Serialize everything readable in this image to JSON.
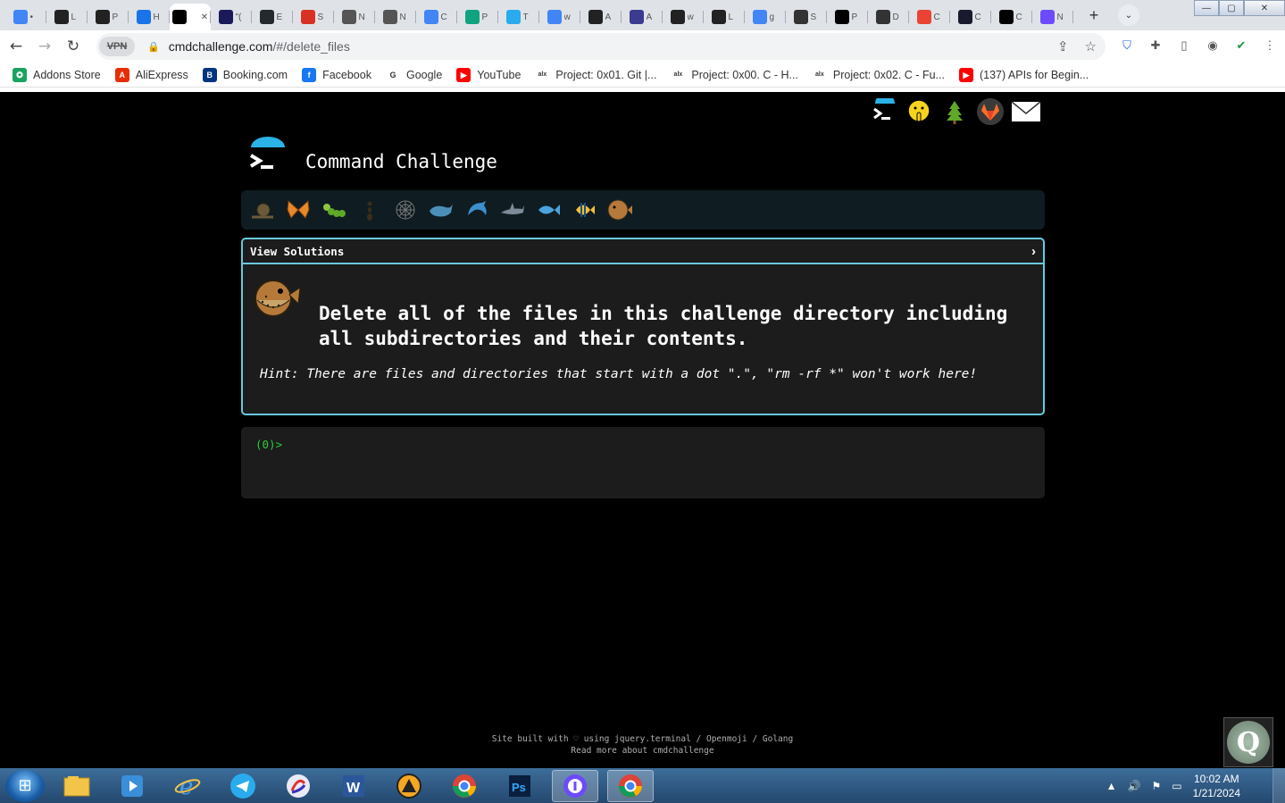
{
  "browser": {
    "tabs": [
      {
        "icon": "chrome-icon",
        "text": "•",
        "color": "#4285f4"
      },
      {
        "icon": "alx-icon",
        "text": "L",
        "color": "#222"
      },
      {
        "icon": "alx-icon",
        "text": "P",
        "color": "#222"
      },
      {
        "icon": "refresh-icon",
        "text": "H",
        "color": "#1a73e8"
      },
      {
        "icon": "terminal-icon",
        "text": "",
        "color": "#000",
        "active": true
      },
      {
        "icon": "intellij-icon",
        "text": "\"(",
        "color": "#1a1a5a"
      },
      {
        "icon": "github-icon",
        "text": "E",
        "color": "#24292e"
      },
      {
        "icon": "gmail-icon",
        "text": "S",
        "color": "#d93025"
      },
      {
        "icon": "alx-icon",
        "text": "N",
        "color": "#555"
      },
      {
        "icon": "alx-icon",
        "text": "N",
        "color": "#555"
      },
      {
        "icon": "docs-icon",
        "text": "C",
        "color": "#4285f4"
      },
      {
        "icon": "chatgpt-icon",
        "text": "P",
        "color": "#10a37f"
      },
      {
        "icon": "telegram-icon",
        "text": "T",
        "color": "#2aabee"
      },
      {
        "icon": "google-icon",
        "text": "w",
        "color": "#4285f4"
      },
      {
        "icon": "alx-icon",
        "text": "A",
        "color": "#222"
      },
      {
        "icon": "globe-icon",
        "text": "A",
        "color": "#3b3b8f"
      },
      {
        "icon": "alx-icon",
        "text": "w",
        "color": "#222"
      },
      {
        "icon": "alx-icon",
        "text": "L",
        "color": "#222"
      },
      {
        "icon": "google-icon",
        "text": "g",
        "color": "#4285f4"
      },
      {
        "icon": "gear-icon",
        "text": "S",
        "color": "#333"
      },
      {
        "icon": "network-icon",
        "text": "P",
        "color": "#000"
      },
      {
        "icon": "download-icon",
        "text": "D",
        "color": "#333"
      },
      {
        "icon": "google-icon",
        "text": "C",
        "color": "#ea4335"
      },
      {
        "icon": "ai-icon",
        "text": "C",
        "color": "#1a1a2e"
      },
      {
        "icon": "terminal-icon",
        "text": "C",
        "color": "#000"
      },
      {
        "icon": "proton-icon",
        "text": "N",
        "color": "#6d4aff"
      }
    ],
    "url_host": "cmdchallenge.com",
    "url_path": "/#/delete_files",
    "vpn_label": "VPN",
    "bookmarks": [
      {
        "label": "Addons Store",
        "icon": "addons-icon",
        "color": "#1aa260",
        "glyph": "✪"
      },
      {
        "label": "AliExpress",
        "icon": "aliexpress-icon",
        "color": "#e62e04",
        "glyph": "A"
      },
      {
        "label": "Booking.com",
        "icon": "booking-icon",
        "color": "#003580",
        "glyph": "B"
      },
      {
        "label": "Facebook",
        "icon": "facebook-icon",
        "color": "#1877f2",
        "glyph": "f"
      },
      {
        "label": "Google",
        "icon": "google-icon",
        "color": "#ffffff",
        "glyph": "G"
      },
      {
        "label": "YouTube",
        "icon": "youtube-icon",
        "color": "#ff0000",
        "glyph": "▶"
      },
      {
        "label": "Project: 0x01. Git |...",
        "icon": "alx-icon",
        "color": "#ffffff",
        "glyph": "alx"
      },
      {
        "label": "Project: 0x00. C - H...",
        "icon": "alx-icon",
        "color": "#ffffff",
        "glyph": "alx"
      },
      {
        "label": "Project: 0x02. C - Fu...",
        "icon": "alx-icon",
        "color": "#ffffff",
        "glyph": "alx"
      },
      {
        "label": "(137) APIs for Begin...",
        "icon": "youtube-icon",
        "color": "#ff0000",
        "glyph": "▶"
      }
    ]
  },
  "site": {
    "title": "Command Challenge",
    "top_icons": [
      "terminal-icon",
      "shushing-face-icon",
      "tree-icon",
      "gitlab-icon",
      "mail-icon"
    ],
    "animals": [
      "snail",
      "butterfly",
      "caterpillar",
      "ant",
      "spider-web",
      "whale",
      "dolphin",
      "shark",
      "fish",
      "tropical-fish",
      "blowfish"
    ],
    "card": {
      "header": "View Solutions",
      "challenge_text": "Delete all of the files in this challenge directory including all subdirectories and their contents.",
      "hint_text": "Hint: There are files and directories that start with a dot \".\", \"rm -rf *\" won't work here!"
    },
    "terminal_prompt": "(0)>",
    "footer_line1": "Site built with ♡ using jquery.terminal / Openmoji / Golang",
    "footer_line2": "Read more about cmdchallenge"
  },
  "taskbar": {
    "apps": [
      "explorer-icon",
      "media-player-icon",
      "internet-explorer-icon",
      "telegram-icon",
      "app-icon",
      "word-icon",
      "aimp-icon",
      "chrome-icon",
      "photoshop-icon",
      "proton-vpn-icon",
      "chrome-icon"
    ],
    "time": "10:02 AM",
    "date": "1/21/2024"
  }
}
